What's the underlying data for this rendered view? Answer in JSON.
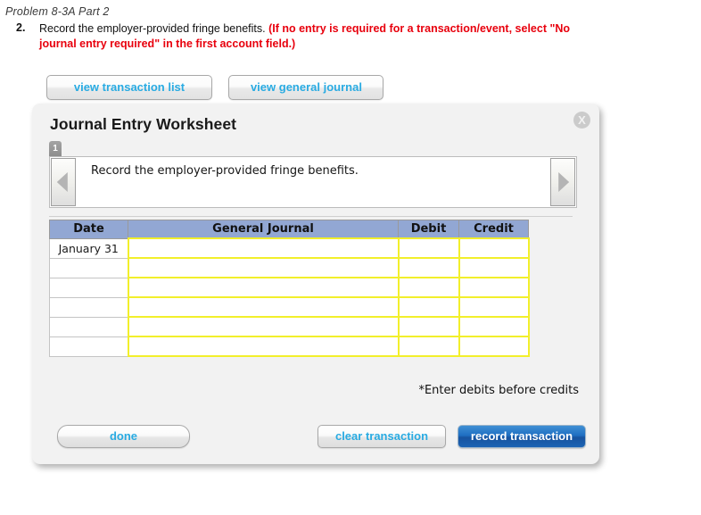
{
  "problem": {
    "title": "Problem 8-3A Part 2",
    "number": "2.",
    "instruction": "Record the employer-provided fringe benefits. ",
    "requirement": "(If no entry is required for a transaction/event, select \"No journal entry required\" in the first account field.)"
  },
  "top_buttons": {
    "view_transaction_list": "view transaction list",
    "view_general_journal": "view general journal"
  },
  "dialog": {
    "title": "Journal Entry Worksheet",
    "close_label": "X",
    "tab_badge": "1",
    "nav_text": "Record the employer-provided fringe benefits.",
    "prev_arrow": "prev-arrow",
    "next_arrow": "next-arrow",
    "note": "*Enter debits before credits"
  },
  "table": {
    "headers": [
      "Date",
      "General Journal",
      "Debit",
      "Credit"
    ],
    "rows": [
      {
        "date": "January 31",
        "journal": "",
        "debit": "",
        "credit": ""
      },
      {
        "date": "",
        "journal": "",
        "debit": "",
        "credit": ""
      },
      {
        "date": "",
        "journal": "",
        "debit": "",
        "credit": ""
      },
      {
        "date": "",
        "journal": "",
        "debit": "",
        "credit": ""
      },
      {
        "date": "",
        "journal": "",
        "debit": "",
        "credit": ""
      },
      {
        "date": "",
        "journal": "",
        "debit": "",
        "credit": ""
      }
    ]
  },
  "footer_buttons": {
    "done": "done",
    "clear_transaction": "clear transaction",
    "record_transaction": "record transaction"
  },
  "colors": {
    "link_blue": "#29abe2",
    "header_blue": "#92a7d3",
    "field_yellow": "#f2ef2b",
    "required_red": "#e8000d",
    "record_blue": "#1f6fc2"
  }
}
